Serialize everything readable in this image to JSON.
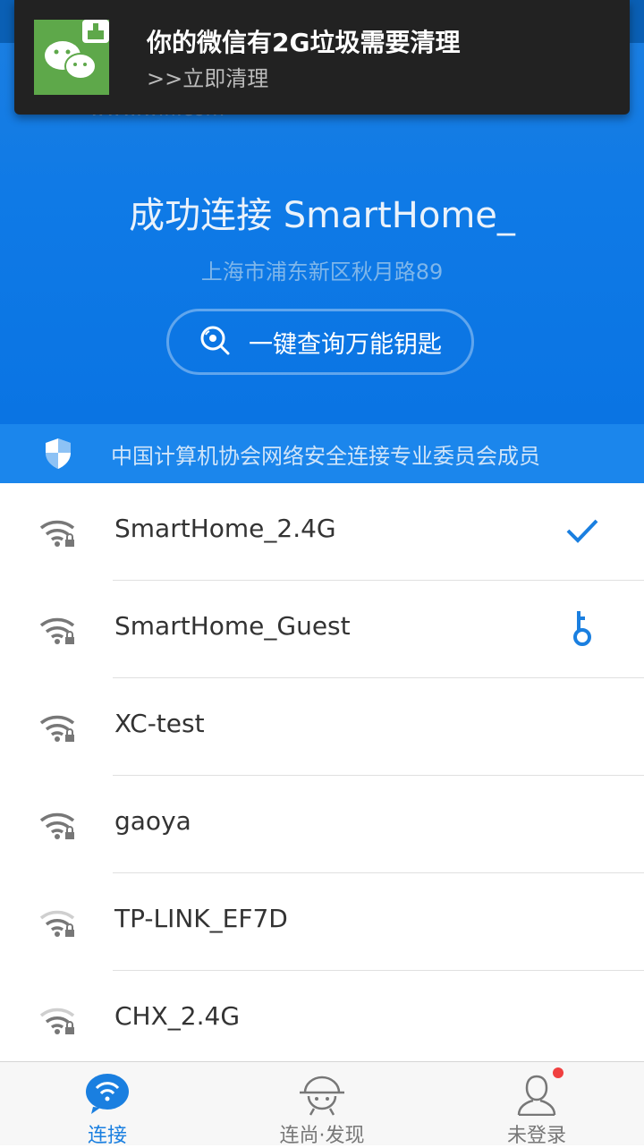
{
  "notification": {
    "title": "你的微信有2G垃圾需要清理",
    "subtitle": ">>立即清理",
    "icon": "wechat-cleaner-icon"
  },
  "hero": {
    "ghost_text": "www.wifi.com",
    "title": "成功连接 SmartHome_",
    "address": "上海市浦东新区秋月路89",
    "key_button_label": "一键查询万能钥匙"
  },
  "security_bar": {
    "text": "中国计算机协会网络安全连接专业委员会成员"
  },
  "wifi_list": [
    {
      "name": "SmartHome_2.4G",
      "status": "connected-check",
      "signal": "strong"
    },
    {
      "name": "SmartHome_Guest",
      "status": "key-available",
      "signal": "strong"
    },
    {
      "name": "XC-test",
      "status": "",
      "signal": "strong"
    },
    {
      "name": "gaoya",
      "status": "",
      "signal": "strong"
    },
    {
      "name": "TP-LINK_EF7D",
      "status": "",
      "signal": "weak"
    },
    {
      "name": "CHX_2.4G",
      "status": "",
      "signal": "weak"
    }
  ],
  "bottom_nav": {
    "items": [
      {
        "label": "连接",
        "icon": "wifi-bubble-icon",
        "active": true
      },
      {
        "label": "连尚·发现",
        "icon": "astronaut-icon",
        "active": false
      },
      {
        "label": "未登录",
        "icon": "user-icon",
        "active": false
      }
    ]
  },
  "colors": {
    "primary": "#0f7ae6",
    "accent": "#1a7fe0",
    "badge": "#f04040"
  }
}
